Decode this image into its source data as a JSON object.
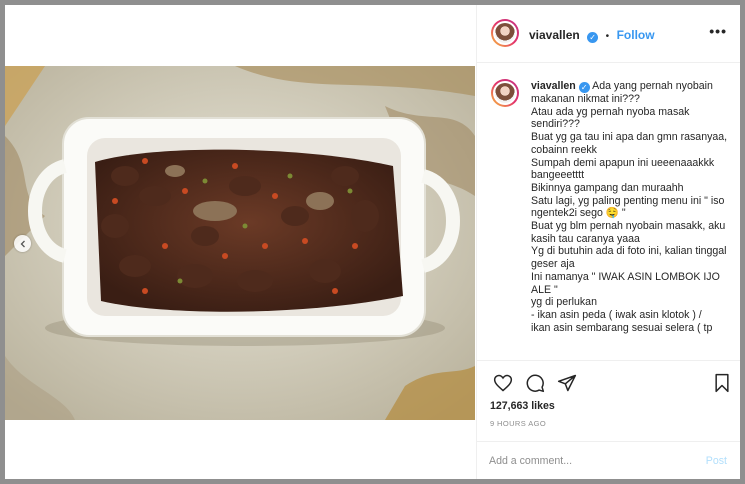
{
  "header": {
    "username": "viavallen",
    "separator": "•",
    "follow_label": "Follow",
    "more_label": "•••"
  },
  "caption": {
    "username": "viavallen",
    "text": "Ada yang pernah nyobain makanan nikmat ini???\nAtau ada yg pernah nyoba masak sendiri???\nBuat yg ga tau ini apa dan gmn rasanyaa, cobainn reekk\nSumpah demi apapun ini ueeenaaakkk bangeeetttt\nBikinnya gampang dan muraahh\nSatu lagi, yg paling penting menu ini \" iso ngentek2i sego 🤤 \"\nBuat yg blm pernah nyobain masakk, aku kasih tau caranya yaaa\nYg di butuhin ada di foto ini, kalian tinggal geser aja\nIni namanya \" IWAK ASIN LOMBOK IJO ALE \"\nyg di perlukan\n- ikan asin peda ( iwak asin klotok ) /\nikan asin sembarang sesuai selera ( tp"
  },
  "stats": {
    "likes": "127,663 likes",
    "time": "9 HOURS AGO"
  },
  "comment": {
    "placeholder": "Add a comment...",
    "post_label": "Post"
  },
  "icons": {
    "like": "heart-icon",
    "comment": "comment-icon",
    "share": "share-icon",
    "save": "bookmark-icon",
    "verified": "verified-badge-icon",
    "carousel_prev": "chevron-left-icon"
  },
  "colors": {
    "link": "#3897f0",
    "text": "#262626",
    "muted": "#8e8e8e",
    "post_disabled": "#b2dffc"
  }
}
